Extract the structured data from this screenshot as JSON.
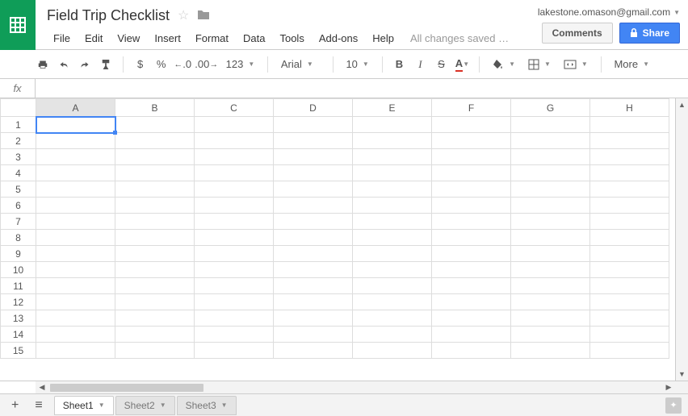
{
  "doc": {
    "title": "Field Trip Checklist",
    "save_status": "All changes saved …"
  },
  "user": {
    "email": "lakestone.omason@gmail.com"
  },
  "menus": [
    "File",
    "Edit",
    "View",
    "Insert",
    "Format",
    "Data",
    "Tools",
    "Add-ons",
    "Help"
  ],
  "buttons": {
    "comments": "Comments",
    "share": "Share"
  },
  "toolbar": {
    "currency": "$",
    "percent": "%",
    "dec_dec": ".0",
    "inc_dec": ".00",
    "num_format": "123",
    "font": "Arial",
    "font_size": "10",
    "bold": "B",
    "italic": "I",
    "strike": "S",
    "color": "A",
    "more": "More"
  },
  "fx": {
    "label": "fx",
    "value": ""
  },
  "columns": [
    "A",
    "B",
    "C",
    "D",
    "E",
    "F",
    "G",
    "H"
  ],
  "rows": [
    "1",
    "2",
    "3",
    "4",
    "5",
    "6",
    "7",
    "8",
    "9",
    "10",
    "11",
    "12",
    "13",
    "14",
    "15"
  ],
  "selected": {
    "col": "A",
    "row": "1"
  },
  "tabs": [
    {
      "name": "Sheet1",
      "active": true
    },
    {
      "name": "Sheet2",
      "active": false
    },
    {
      "name": "Sheet3",
      "active": false
    }
  ]
}
